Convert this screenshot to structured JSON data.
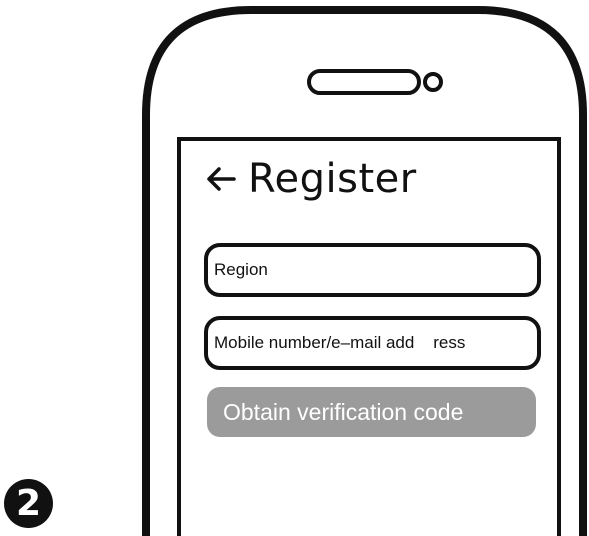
{
  "step_number": "2",
  "screen": {
    "back_icon": "left-arrow-icon",
    "title": "Register"
  },
  "form": {
    "region_field": "Region",
    "contact_field": "Mobile number/e–mail add    ress",
    "obtain_button": "Obtain verification code"
  },
  "colors": {
    "outline": "#111111",
    "button_background": "#9b9b9b",
    "button_text": "#ffffff"
  }
}
